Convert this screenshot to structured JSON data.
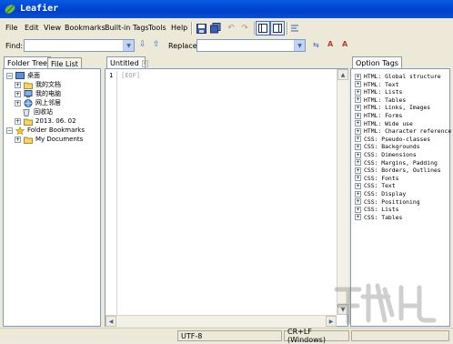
{
  "window": {
    "title": "Leafier"
  },
  "menu": [
    "File",
    "Edit",
    "View",
    "Bookmarks",
    "Built-in Tags",
    "Tools",
    "Help"
  ],
  "findbar": {
    "find_label": "Find:",
    "find_value": "",
    "replace_label": "Replace:",
    "replace_value": ""
  },
  "left_panel": {
    "tabs": [
      "Folder Tree",
      "File List"
    ],
    "tree": [
      {
        "label": "桌面",
        "icon": "desktop-icon",
        "expander": "minus"
      },
      {
        "label": "我的文档",
        "icon": "folder-icon",
        "expander": "plus"
      },
      {
        "label": "我的电脑",
        "icon": "computer-icon",
        "expander": "plus"
      },
      {
        "label": "网上邻居",
        "icon": "network-icon",
        "expander": "plus"
      },
      {
        "label": "回收站",
        "icon": "recycle-bin-icon",
        "expander": "none"
      },
      {
        "label": "2013. 06. 02",
        "icon": "folder-icon",
        "expander": "plus"
      },
      {
        "label": "Folder Bookmarks",
        "icon": "star-icon",
        "expander": "minus"
      },
      {
        "label": "My Documents",
        "icon": "folder-icon",
        "expander": "plus"
      }
    ]
  },
  "editor": {
    "tab": "Untitled",
    "line_number": "1",
    "eof_marker": "[EOF]"
  },
  "right_panel": {
    "tab": "Option Tags",
    "tags": [
      "HTML: Global structure",
      "HTML: Text",
      "HTML: Lists",
      "HTML: Tables",
      "HTML: Links, Images",
      "HTML: Forms",
      "HTML: Wide use",
      "HTML: Character reference",
      "CSS: Pseudo-classes",
      "CSS: Backgrounds",
      "CSS: Dimensions",
      "CSS: Margins, Padding",
      "CSS: Borders, Outlines",
      "CSS: Fonts",
      "CSS: Text",
      "CSS: Display",
      "CSS: Positioning",
      "CSS: Lists",
      "CSS: Tables"
    ]
  },
  "status": {
    "encoding": "UTF-8",
    "line_ending": "CR+LF (Windows)"
  },
  "colors": {
    "titlebar": "#0a50d8",
    "accent": "#4a6ea9"
  }
}
